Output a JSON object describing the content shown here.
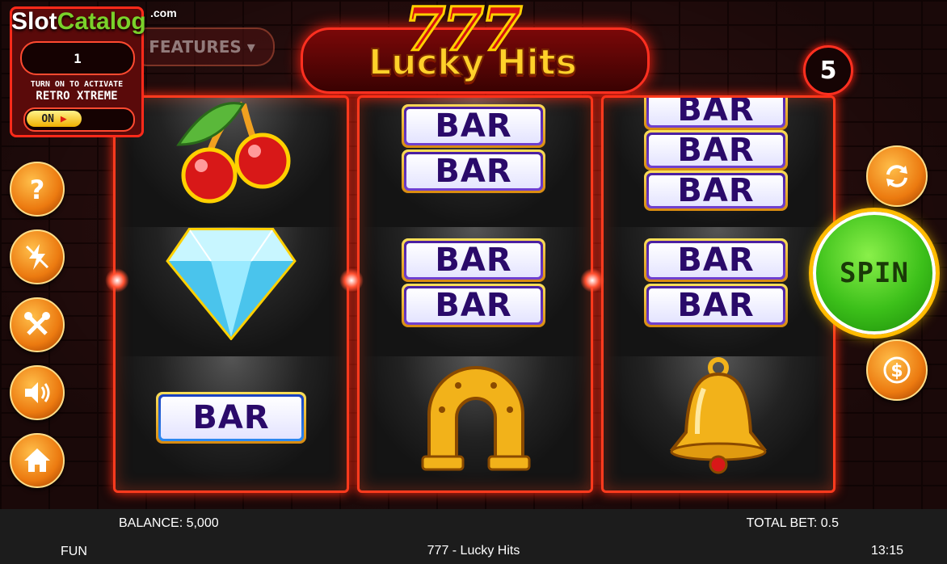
{
  "branding": {
    "logo_slot": "Slot",
    "logo_catalog": "Catalog",
    "logo_com": ".com"
  },
  "retro_panel": {
    "counter_value": "1",
    "hint_line1": "TURN ON TO ACTIVATE",
    "hint_line2": "RETRO XTREME",
    "toggle_label": "ON"
  },
  "features_button": {
    "label": "FEATURES ▾"
  },
  "title": {
    "number": "777",
    "name": "Lucky Hits"
  },
  "paylines": "5",
  "reels": [
    [
      "cherry",
      "diamond",
      "bar"
    ],
    [
      "double-bar",
      "double-bar",
      "horseshoe"
    ],
    [
      "triple-bar",
      "double-bar",
      "bell"
    ]
  ],
  "symbols": {
    "bar_text": "BAR"
  },
  "side_buttons_left": [
    "help-icon",
    "turbo-off-icon",
    "settings-icon",
    "sound-icon",
    "home-icon"
  ],
  "side_buttons_right": [
    "autoplay-icon",
    "bet-icon"
  ],
  "spin_label": "SPIN",
  "status": {
    "balance": "BALANCE: 5,000",
    "total_bet": "TOTAL BET: 0.5",
    "mode": "FUN",
    "game_name": "777 - Lucky Hits",
    "time": "13:15"
  },
  "colors": {
    "neon": "#ff3b1e",
    "spin": "#3cc01a",
    "button": "#ec7a10",
    "title": "#ffd12a"
  }
}
